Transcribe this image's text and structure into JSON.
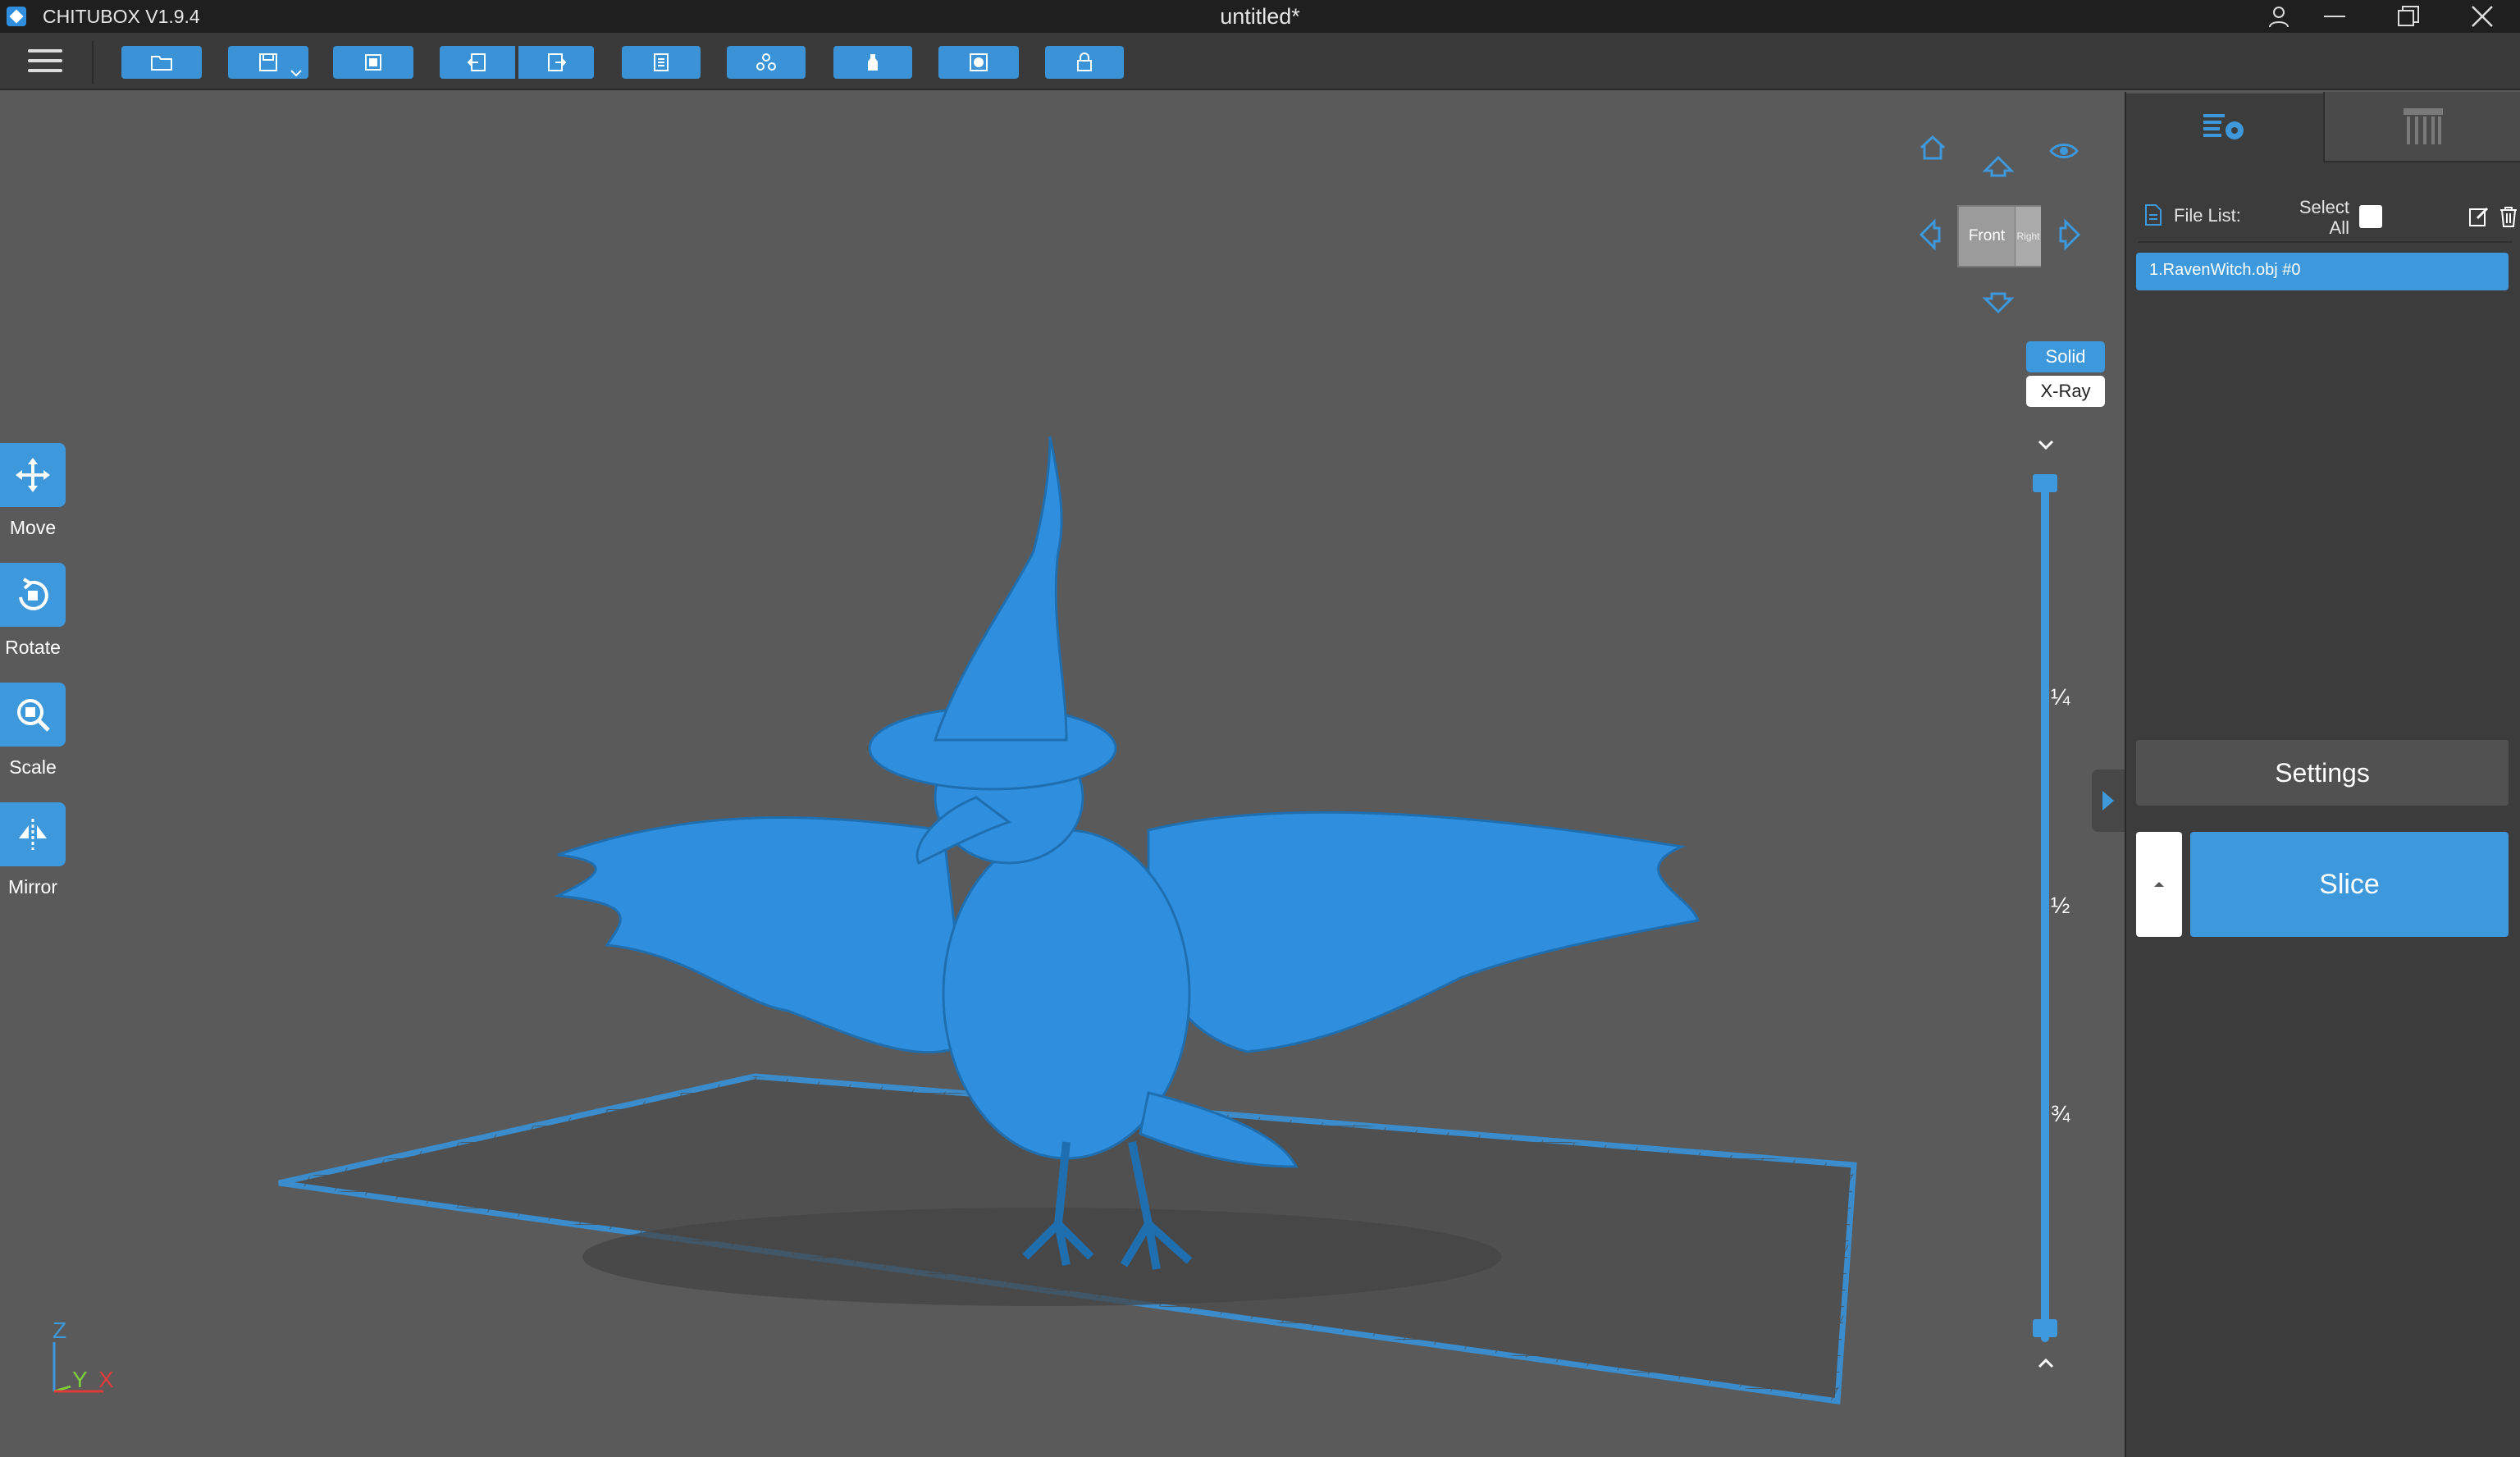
{
  "window": {
    "app_name": "CHITUBOX V1.9.4",
    "document_title": "untitled*"
  },
  "toolbar": {
    "buttons": [
      "open-file",
      "save",
      "auto-layout",
      "undo",
      "redo",
      "slice-list",
      "auto-support",
      "hollow",
      "dig-hole",
      "lock"
    ]
  },
  "left_tools": [
    {
      "label": "Move",
      "icon": "move-icon"
    },
    {
      "label": "Rotate",
      "icon": "rotate-icon"
    },
    {
      "label": "Scale",
      "icon": "scale-icon"
    },
    {
      "label": "Mirror",
      "icon": "mirror-icon"
    }
  ],
  "view": {
    "cube_front": "Front",
    "cube_right": "Right",
    "solid_label": "Solid",
    "xray_label": "X-Ray",
    "active_mode": "Solid"
  },
  "layer_slider": {
    "marks": [
      "¼",
      "½",
      "¾"
    ]
  },
  "axis": {
    "z": "Z",
    "y": "Y",
    "x": "X"
  },
  "right_panel": {
    "file_list_label": "File List:",
    "select_all_label": "Select All",
    "files": [
      "1.RavenWitch.obj #0"
    ],
    "settings_label": "Settings",
    "slice_label": "Slice"
  },
  "colors": {
    "accent": "#3e98dc",
    "model": "#2f8fde",
    "viewport_bg": "#5a5a5a",
    "panel_bg": "#3c3c3c",
    "titlebar_bg": "#1f1f1f"
  }
}
